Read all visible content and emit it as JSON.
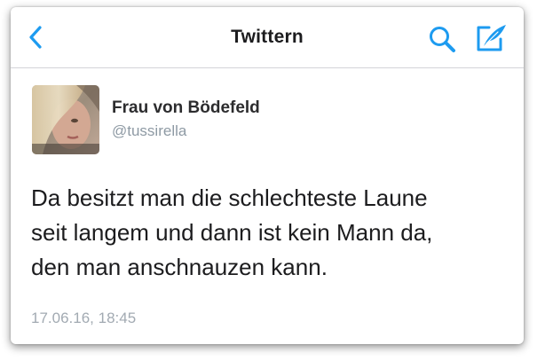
{
  "nav": {
    "title": "Twittern",
    "back_icon": "chevron-left-icon",
    "search_icon": "search-icon",
    "compose_icon": "compose-tweet-icon"
  },
  "tweet": {
    "author_name": "Frau von Bödefeld",
    "author_handle": "@tussirella",
    "text": "Da besitzt man die schlechteste Laune\nseit langem und dann ist kein Mann da,\nden man anschnauzen kann.",
    "timestamp": "17.06.16, 18:45"
  },
  "colors": {
    "accent": "#1d9bf0",
    "title": "#1c1c1e",
    "handle": "#8e9aa4",
    "timestamp": "#a2aab2"
  }
}
